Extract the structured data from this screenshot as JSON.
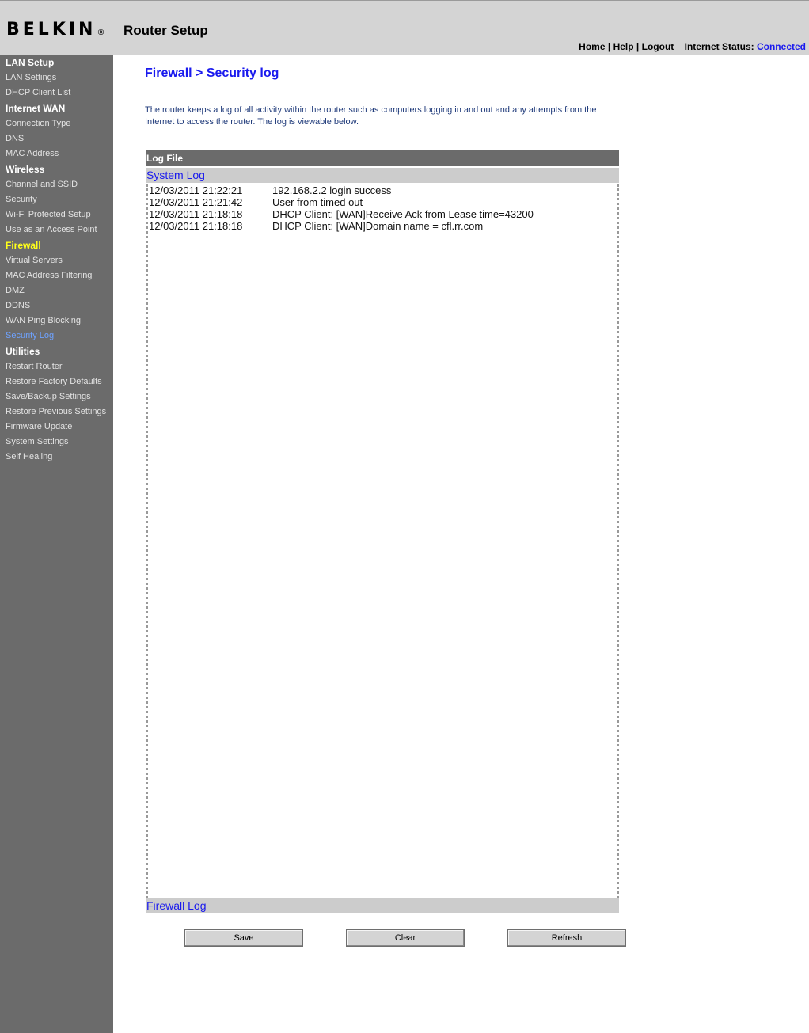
{
  "header": {
    "logo": "BELKIN",
    "logo_reg": "®",
    "title": "Router Setup",
    "links": {
      "home": "Home",
      "help": "Help",
      "logout": "Logout",
      "sep": "|"
    },
    "status_label": "Internet Status:",
    "status_value": "Connected"
  },
  "sidebar": {
    "lan_setup": "LAN Setup",
    "lan_settings": "LAN Settings",
    "dhcp_client_list": "DHCP Client List",
    "internet_wan": "Internet WAN",
    "connection_type": "Connection Type",
    "dns": "DNS",
    "mac_address": "MAC Address",
    "wireless": "Wireless",
    "channel_ssid": "Channel and SSID",
    "security": "Security",
    "wifi_protected": "Wi-Fi Protected Setup",
    "access_point": "Use as an Access Point",
    "firewall": "Firewall",
    "virtual_servers": "Virtual Servers",
    "mac_filtering": "MAC Address Filtering",
    "dmz": "DMZ",
    "ddns": "DDNS",
    "wan_ping": "WAN Ping Blocking",
    "security_log": "Security Log",
    "utilities": "Utilities",
    "restart_router": "Restart Router",
    "restore_factory": "Restore Factory Defaults",
    "save_backup": "Save/Backup Settings",
    "restore_previous": "Restore Previous Settings",
    "firmware_update": "Firmware Update",
    "system_settings": "System Settings",
    "self_healing": "Self Healing"
  },
  "main": {
    "heading": "Firewall > Security log",
    "intro": "The router keeps a log of all activity within the router such as computers logging in and out and any attempts from the Internet to access the router. The log is viewable below.",
    "log_file_label": "Log File",
    "system_log_label": "System Log",
    "firewall_log_label": "Firewall Log",
    "log_entries": [
      {
        "time": "12/03/2011 21:22:21",
        "message": "192.168.2.2 login success"
      },
      {
        "time": "12/03/2011 21:21:42",
        "message": "User from          timed out"
      },
      {
        "time": "12/03/2011 21:18:18",
        "message": "DHCP Client: [WAN]Receive Ack from           Lease time=43200"
      },
      {
        "time": "12/03/2011 21:18:18",
        "message": "DHCP Client: [WAN]Domain name = cfl.rr.com"
      }
    ],
    "buttons": {
      "save": "Save",
      "clear": "Clear",
      "refresh": "Refresh"
    }
  }
}
